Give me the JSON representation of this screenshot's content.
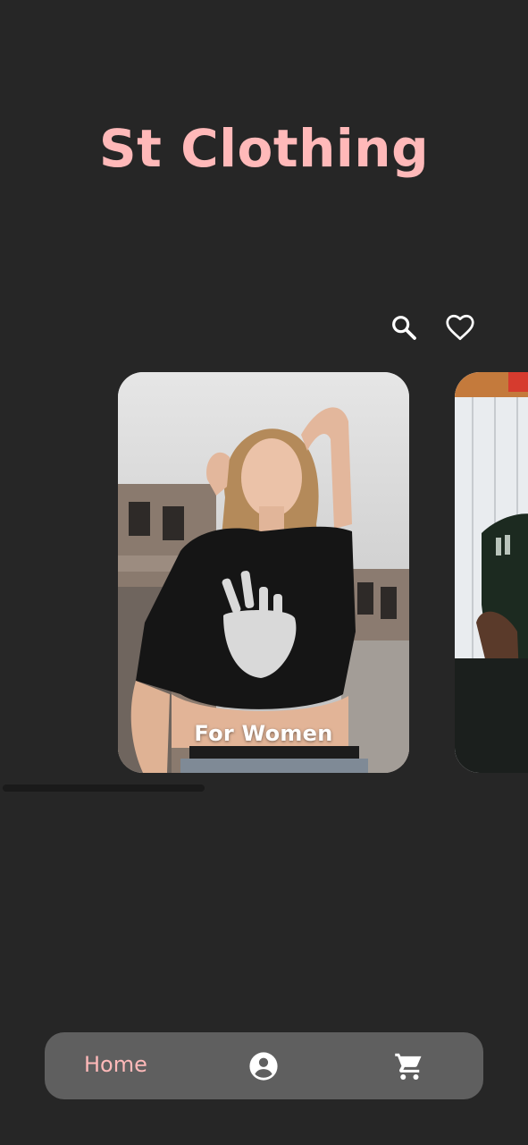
{
  "app": {
    "title": "St Clothing"
  },
  "header_actions": {
    "search_icon": "search-icon",
    "favorite_icon": "heart-outline-icon"
  },
  "categories": [
    {
      "label": "For Women"
    },
    {
      "label": ""
    }
  ],
  "bottom_nav": {
    "home_label": "Home",
    "profile_icon": "account-circle-icon",
    "cart_icon": "shopping-cart-icon"
  },
  "colors": {
    "background": "#262626",
    "accent": "#FFB9B9",
    "nav_background": "#5F5F5F"
  }
}
